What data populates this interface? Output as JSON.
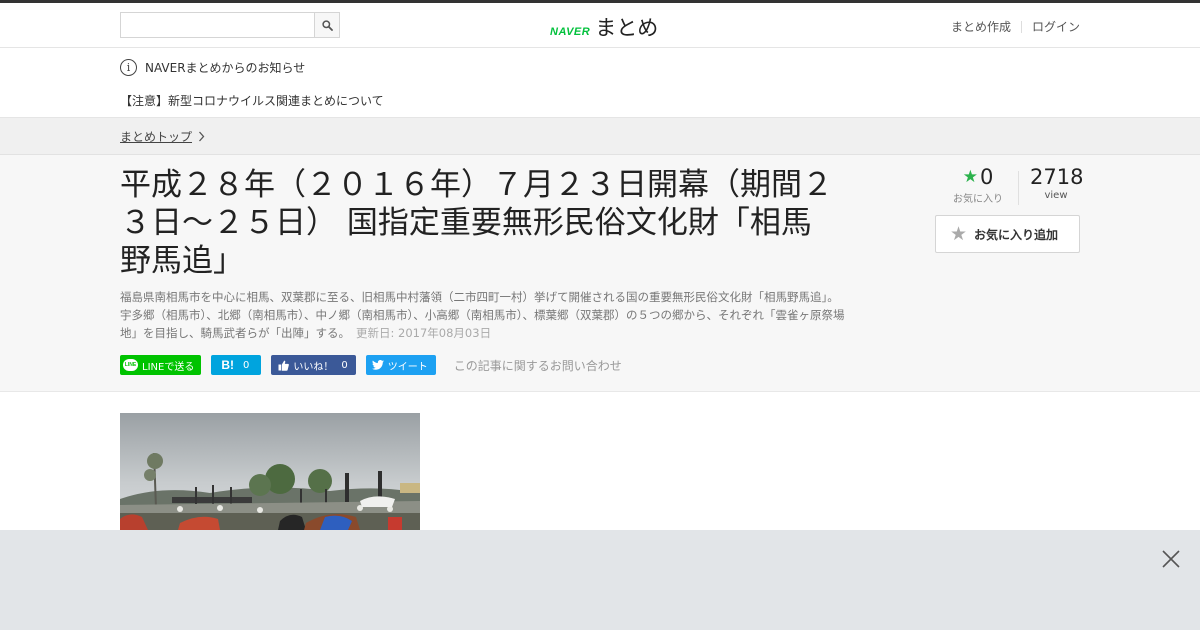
{
  "header": {
    "search_placeholder": "",
    "logo_brand": "NAVER",
    "logo_name": "まとめ",
    "links": [
      "まとめ作成",
      "ログイン"
    ]
  },
  "notice": {
    "title": "NAVERまとめからのお知らせ",
    "item": "【注意】新型コロナウイルス関連まとめについて"
  },
  "breadcrumb": {
    "label": "まとめトップ"
  },
  "article": {
    "title": "平成２８年（２０１６年）７月２３日開幕（期間２３日～２５日） 国指定重要無形民俗文化財「相馬野馬追」",
    "description": "福島県南相馬市を中心に相馬、双葉郡に至る、旧相馬中村藩領（二市四町一村）挙げて開催される国の重要無形民俗文化財「相馬野馬追」。宇多郷（相馬市）、北郷（南相馬市）、中ノ郷（南相馬市）、小高郷（南相馬市）、標葉郷（双葉郡）の５つの郷から、それぞれ「雲雀ヶ原祭場地」を目指し、騎馬武者らが「出陣」する。",
    "updated": "更新日: 2017年08月03日"
  },
  "share": {
    "line_label": "LINEで送る",
    "line_badge": "LINE",
    "hatena_icon": "B!",
    "hatena_count": "0",
    "fb_label": "いいね！",
    "fb_count": "0",
    "tweet_label": "ツイート",
    "contact_label": "この記事に関するお問い合わせ"
  },
  "stats": {
    "favorites": "0",
    "favorites_label": "お気に入り",
    "views": "2718",
    "views_label": "view",
    "add_favorite_label": "お気に入り追加"
  },
  "colors": {
    "naver_green": "#03c13d",
    "line_green": "#00c300",
    "hatena_blue": "#00a4de",
    "facebook_blue": "#3b5998",
    "twitter_blue": "#1da1f2",
    "favorite_star": "#2bb24c",
    "ad_bar": "#e2e5e8"
  },
  "icons": [
    "search-icon",
    "info-icon",
    "chevron-right-icon",
    "line-icon",
    "hatena-icon",
    "thumbs-up-icon",
    "twitter-bird-icon",
    "star-icon",
    "close-icon"
  ]
}
